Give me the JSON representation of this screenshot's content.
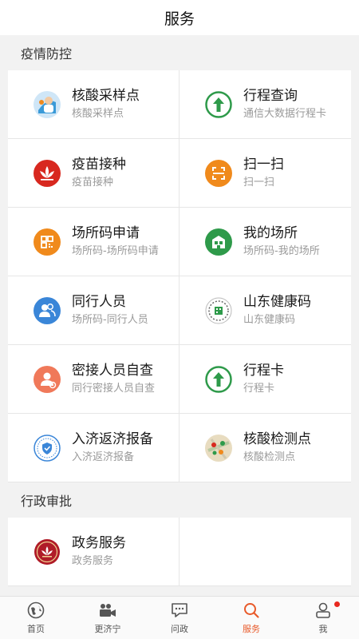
{
  "header": {
    "title": "服务"
  },
  "sections": [
    {
      "title": "疫情防控",
      "items": [
        {
          "label": "核酸采样点",
          "sub": "核酸采样点",
          "icon": "nucleic-sampling-icon"
        },
        {
          "label": "行程查询",
          "sub": "通信大数据行程卡",
          "icon": "itinerary-arrow-icon"
        },
        {
          "label": "疫苗接种",
          "sub": "疫苗接种",
          "icon": "vaccine-lotus-icon"
        },
        {
          "label": "扫一扫",
          "sub": "扫一扫",
          "icon": "scan-icon"
        },
        {
          "label": "场所码申请",
          "sub": "场所码-场所码申请",
          "icon": "qr-code-icon"
        },
        {
          "label": "我的场所",
          "sub": "场所码-我的场所",
          "icon": "my-venue-icon"
        },
        {
          "label": "同行人员",
          "sub": "场所码-同行人员",
          "icon": "companions-icon"
        },
        {
          "label": "山东健康码",
          "sub": "山东健康码",
          "icon": "health-code-icon"
        },
        {
          "label": "密接人员自查",
          "sub": "同行密接人员自查",
          "icon": "contact-check-icon"
        },
        {
          "label": "行程卡",
          "sub": "行程卡",
          "icon": "itinerary-card-icon"
        },
        {
          "label": "入济返济报备",
          "sub": "入济返济报备",
          "icon": "shield-badge-icon"
        },
        {
          "label": "核酸检测点",
          "sub": "核酸检测点",
          "icon": "map-pin-icon"
        }
      ]
    },
    {
      "title": "行政审批",
      "items": [
        {
          "label": "政务服务",
          "sub": "政务服务",
          "icon": "government-emblem-icon"
        }
      ]
    }
  ],
  "tabbar": {
    "items": [
      {
        "label": "首页",
        "icon": "home-globe-icon",
        "active": false
      },
      {
        "label": "更济宁",
        "icon": "video-camera-icon",
        "active": false
      },
      {
        "label": "问政",
        "icon": "chat-bubble-icon",
        "active": false
      },
      {
        "label": "服务",
        "icon": "search-icon",
        "active": true
      },
      {
        "label": "我",
        "icon": "user-icon",
        "active": false,
        "badge": true
      }
    ]
  },
  "colors": {
    "accent": "#e85a2a",
    "green": "#2e9a4a",
    "orange": "#f08a1c",
    "blue": "#3a86d8",
    "red": "#d8281f"
  }
}
